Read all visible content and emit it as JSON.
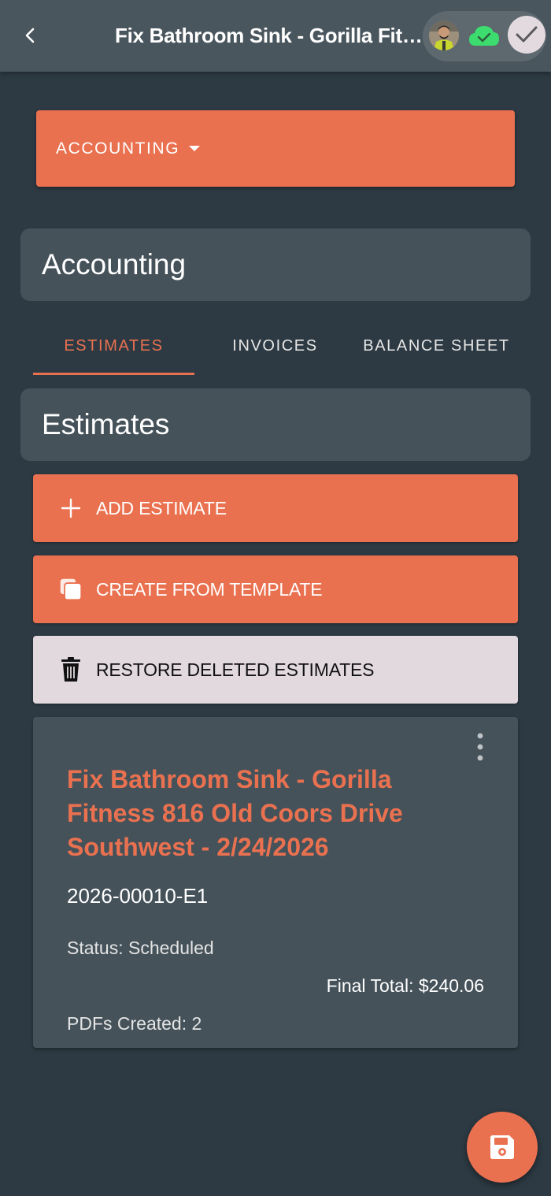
{
  "header": {
    "title": "Fix Bathroom Sink - Gorilla Fitn...",
    "back_icon": "chevron-left-icon",
    "sync_icon": "cloud-check-icon",
    "done_icon": "check-icon"
  },
  "section_dropdown": {
    "label": "ACCOUNTING"
  },
  "accounting_card": {
    "title": "Accounting"
  },
  "tabs": [
    {
      "label": "ESTIMATES",
      "active": true
    },
    {
      "label": "INVOICES",
      "active": false
    },
    {
      "label": "BALANCE SHEET",
      "active": false
    }
  ],
  "estimates_card": {
    "title": "Estimates"
  },
  "actions": {
    "add": {
      "label": "ADD ESTIMATE",
      "icon": "plus-icon"
    },
    "template": {
      "label": "CREATE FROM TEMPLATE",
      "icon": "copy-icon"
    },
    "restore": {
      "label": "RESTORE DELETED ESTIMATES",
      "icon": "trash-icon"
    }
  },
  "estimate": {
    "title": "Fix Bathroom Sink - Gorilla Fitness 816 Old Coors Drive Southwest - 2/24/2026",
    "number": "2026-00010-E1",
    "status": "Status: Scheduled",
    "final_total": "Final Total: $240.06",
    "pdfs_created": "PDFs Created: 2"
  },
  "fab": {
    "icon": "save-icon"
  },
  "colors": {
    "accent": "#ea7150",
    "background": "#2d3a43",
    "card": "#45525a",
    "appbar": "#4a565e",
    "sync_green": "#3ddc6e"
  }
}
